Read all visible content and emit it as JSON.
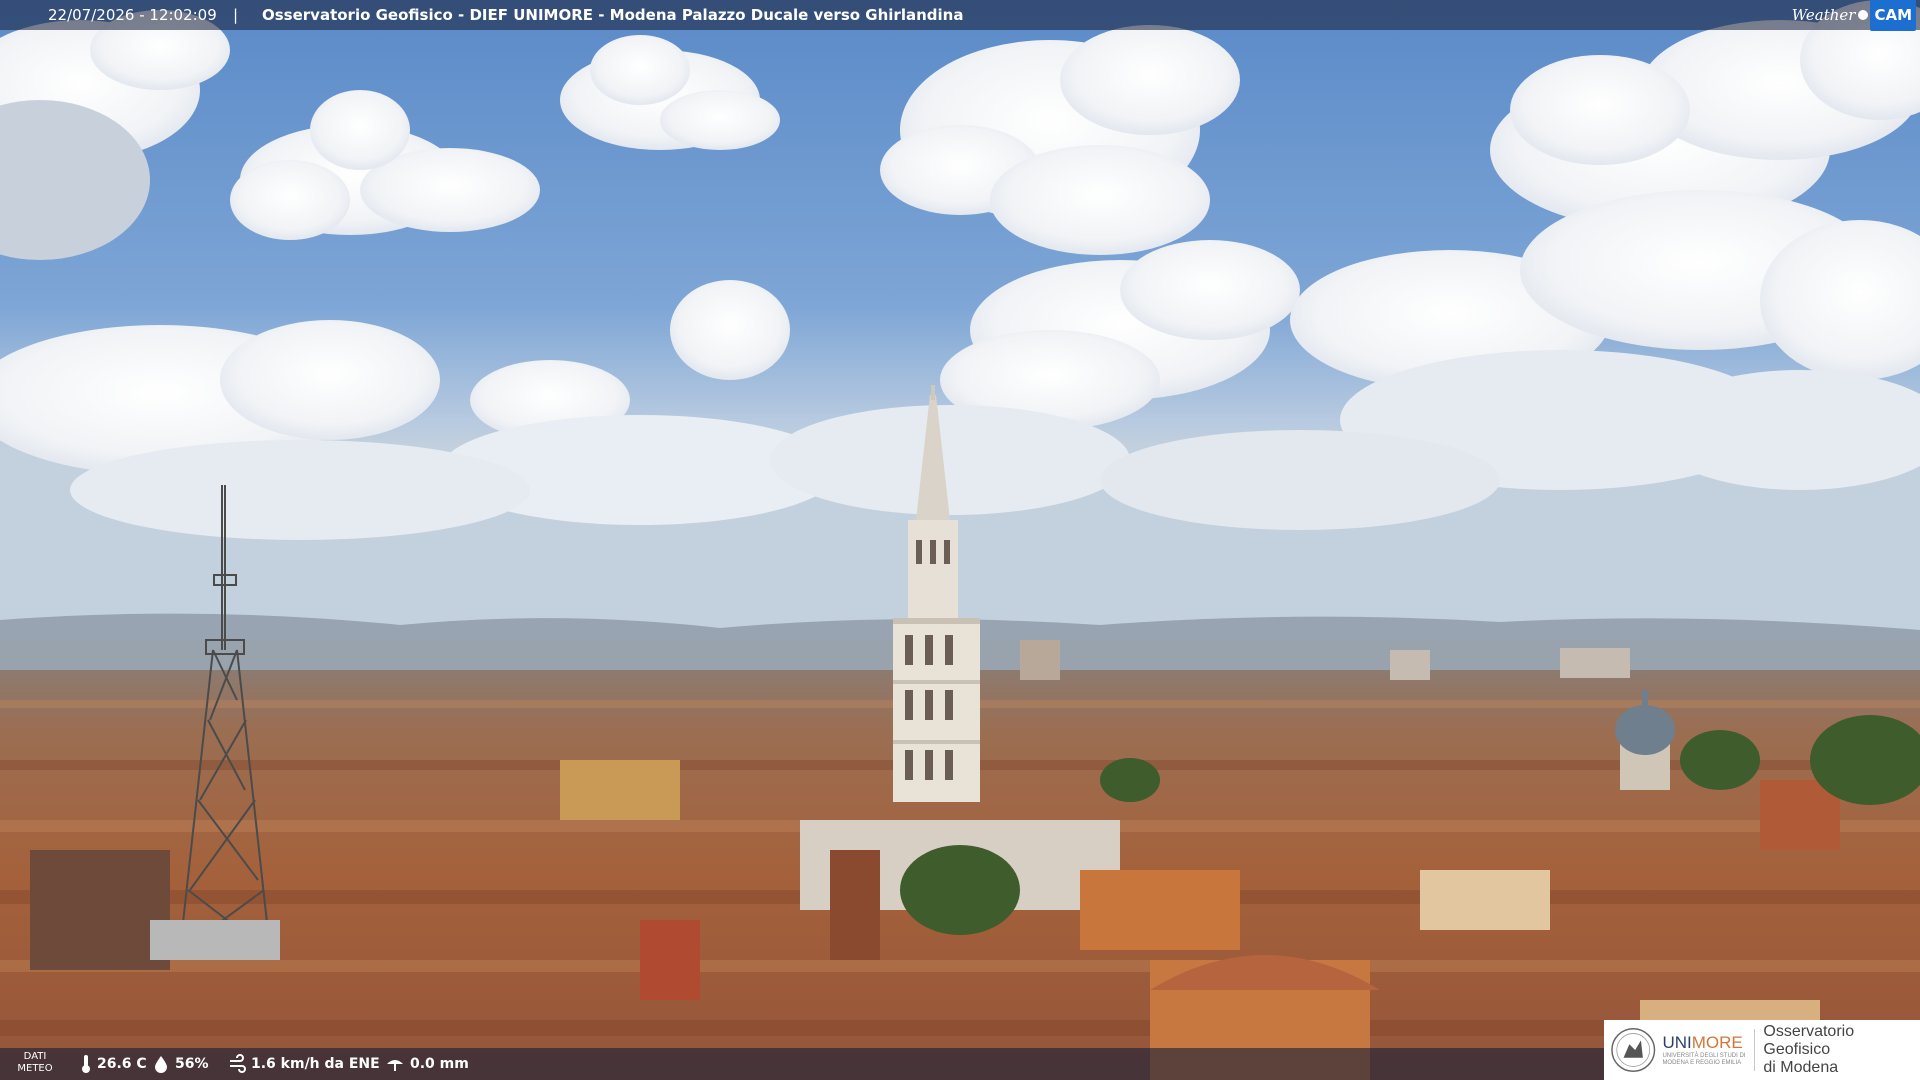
{
  "overlay": {
    "timestamp": "22/07/2026 - 12:02:09",
    "separator": "|",
    "title": "Osservatorio Geofisico - DIEF UNIMORE - Modena Palazzo Ducale verso Ghirlandina",
    "brand_weather": "Weather",
    "brand_cam": "CAM"
  },
  "meteo": {
    "label_line1": "DATI",
    "label_line2": "METEO",
    "temperature": "26.6 C",
    "humidity": "56%",
    "wind": "1.6 km/h da ENE",
    "rain": "0.0 mm"
  },
  "logo": {
    "university": "UNI",
    "university_accent": "MORE",
    "university_sub": "UNIVERSITÀ DEGLI STUDI DI MODENA E REGGIO EMILIA",
    "observatory_line1": "Osservatorio Geofisico",
    "observatory_line2": "di Modena"
  },
  "colors": {
    "sky_top": "#5f8fcc",
    "sky_horizon": "#b9cbe0",
    "roof": "#a0603c",
    "overlay_bar": "#141e37",
    "unimore_blue": "#2b3f6e",
    "unimore_orange": "#d1763a"
  },
  "icons": [
    "thermometer-icon",
    "humidity-icon",
    "wind-icon",
    "rain-icon",
    "weathercam-logo",
    "unimore-seal"
  ]
}
